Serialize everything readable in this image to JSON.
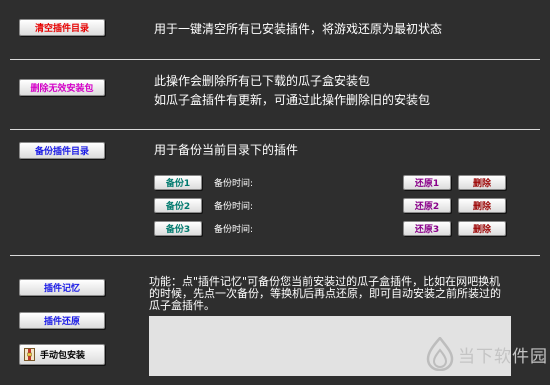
{
  "colors": {
    "background": "#2e2e2e",
    "red": "#e60000",
    "magenta": "#d400c8",
    "blue": "#1a1ae6",
    "teal": "#007a6e",
    "purple": "#8a008a",
    "darkred": "#9a0000"
  },
  "clear": {
    "button": "清空插件目录",
    "desc": "用于一键清空所有已安装插件，将游戏还原为最初状态"
  },
  "delete_pkg": {
    "button": "删除无效安装包",
    "desc1": "此操作会删除所有已下载的瓜子盒安装包",
    "desc2": "如瓜子盒插件有更新，可通过此操作删除旧的安装包"
  },
  "backup": {
    "button": "备份插件目录",
    "desc": "用于备份当前目录下的插件",
    "time_label": "备份时间:",
    "slots": [
      {
        "backup": "备份1",
        "restore": "还原1",
        "delete": "删除"
      },
      {
        "backup": "备份2",
        "restore": "还原2",
        "delete": "删除"
      },
      {
        "backup": "备份3",
        "restore": "还原3",
        "delete": "删除"
      }
    ]
  },
  "memory": {
    "memory_button": "插件记忆",
    "restore_button": "插件还原",
    "manual_button": "手动包安装",
    "desc": "功能：点\"插件记忆\"可备份您当前安装过的瓜子盒插件，比如在网吧换机的时候，先点一次备份，等换机后再点还原，即可自动安装之前所装过的瓜子盒插件。"
  },
  "watermark": {
    "text": "当下软件园",
    "icon": "flame-logo-icon"
  }
}
